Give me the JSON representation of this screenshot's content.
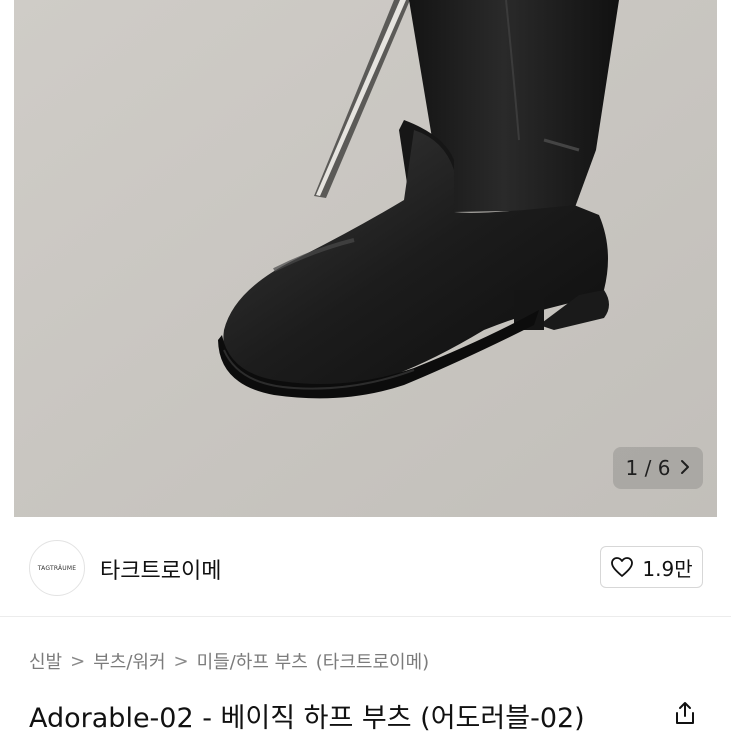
{
  "gallery": {
    "counter": "1 / 6",
    "next_icon": "chevron-right-icon"
  },
  "seller": {
    "avatar_text": "TAGTRÄUME",
    "name": "타크트로이메"
  },
  "like": {
    "icon": "heart-icon",
    "count": "1.9만"
  },
  "breadcrumb": {
    "items": [
      "신발",
      "부츠/워커",
      "미들/하프 부츠",
      "(타크트로이메)"
    ],
    "separator": ">"
  },
  "product": {
    "title": "Adorable-02 - 베이직 하프 부츠 (어도러블-02)",
    "share_icon": "share-icon"
  }
}
